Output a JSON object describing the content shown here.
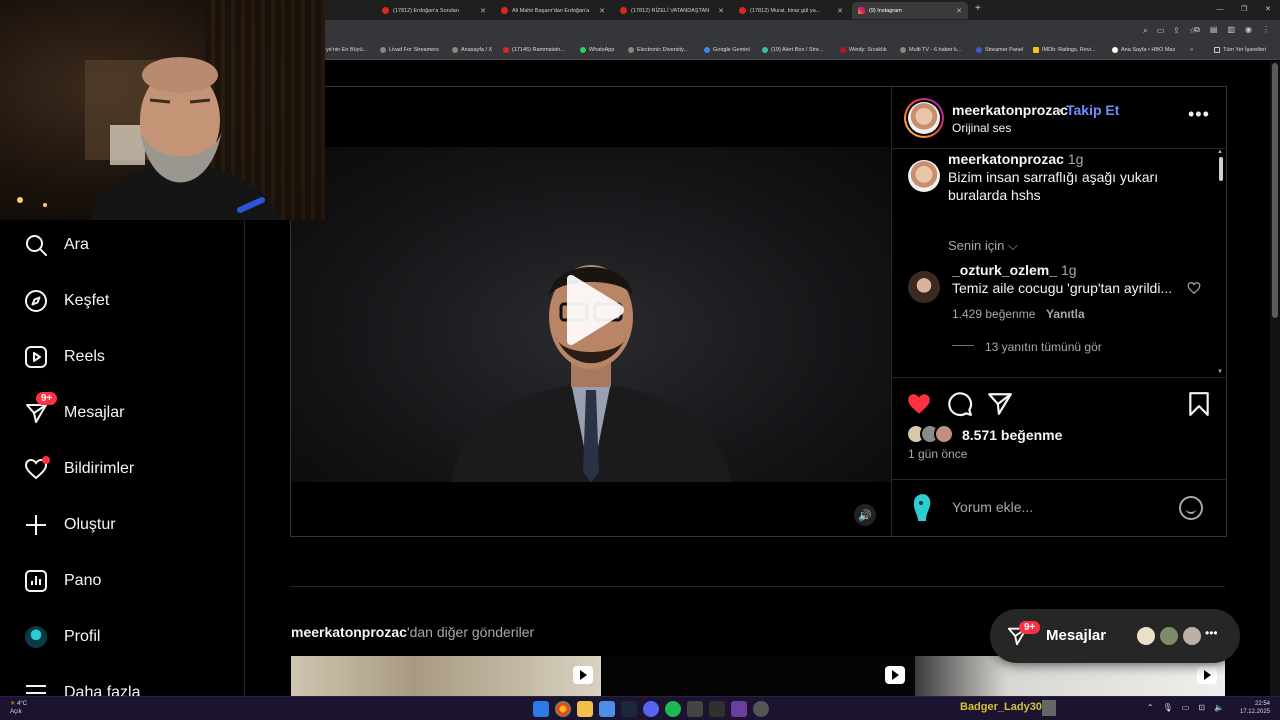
{
  "browser": {
    "tabs": [
      {
        "label": "(17812) Erdoğan'a Sorulan",
        "favicon": "youtube",
        "active": false
      },
      {
        "label": "Ali Mahir Başarır'dan Erdoğan'a",
        "favicon": "youtube",
        "active": false
      },
      {
        "label": "(17812) RİZELİ VATANDAŞTAN",
        "favicon": "youtube",
        "active": false
      },
      {
        "label": "(17812) Murat, biraz gül ya...",
        "favicon": "youtube",
        "active": false
      },
      {
        "label": "(9) Instagram",
        "favicon": "instagram",
        "active": true
      }
    ],
    "bookmarks": [
      "ye'nin En Büyü...",
      "Livad For Streamers",
      "Anasayfa / X",
      "(17145) Rammstein...",
      "WhatsApp",
      "Electronic Diversity...",
      "Google Gemini",
      "(19) Alert Box / Stre...",
      "Windy: Sıcaklık",
      "Multi TV - 6 haber k...",
      "Streamer Panel",
      "IMDb: Ratings, Revi...",
      "Ana Sayfa • HBO Max",
      "Tüm Yer İşaretleri"
    ]
  },
  "sidebar": {
    "items": [
      {
        "label": "Ara",
        "icon": "search-icon"
      },
      {
        "label": "Keşfet",
        "icon": "compass-icon"
      },
      {
        "label": "Reels",
        "icon": "reels-icon"
      },
      {
        "label": "Mesajlar",
        "icon": "messenger-icon",
        "badge": "9+"
      },
      {
        "label": "Bildirimler",
        "icon": "heart-icon"
      },
      {
        "label": "Oluştur",
        "icon": "plus-icon"
      },
      {
        "label": "Pano",
        "icon": "dashboard-icon"
      },
      {
        "label": "Profil",
        "icon": "profile-avatar"
      },
      {
        "label": "Daha fazla",
        "icon": "menu-icon"
      }
    ]
  },
  "post": {
    "username": "meerkatonprozac",
    "separator": "•",
    "follow": "Takip Et",
    "audio": "Orijinal ses",
    "caption_user": "meerkatonprozac",
    "caption_time": "1g",
    "caption_text_1": "Bizim insan sarraflığı aşağı yukarı",
    "caption_text_2": "buralarda hshs",
    "for_you": "Senin için",
    "comment": {
      "user": "_ozturk_ozlem_",
      "time": "1g",
      "text": "Temiz aile cocugu 'grup'tan ayrildi...",
      "likes": "1.429 beğenme",
      "reply": "Yanıtla",
      "view_replies": "13 yanıtın tümünü gör"
    },
    "likes": "8.571 beğenme",
    "ago": "1 gün önce",
    "add_comment": "Yorum ekle..."
  },
  "more_posts": {
    "user": "meerkatonprozac",
    "suffix": "'dan diğer gönderiler"
  },
  "messages_pill": {
    "label": "Mesajlar",
    "badge": "9+"
  },
  "taskbar": {
    "weather_temp": "4°C",
    "weather_text": "Açık",
    "overlay_name": "Badger_Lady30",
    "time": "22:54",
    "date": "17.12.2025"
  },
  "colors": {
    "accent": "#6f8dff",
    "like": "#ff3040",
    "bg": "#000000"
  }
}
